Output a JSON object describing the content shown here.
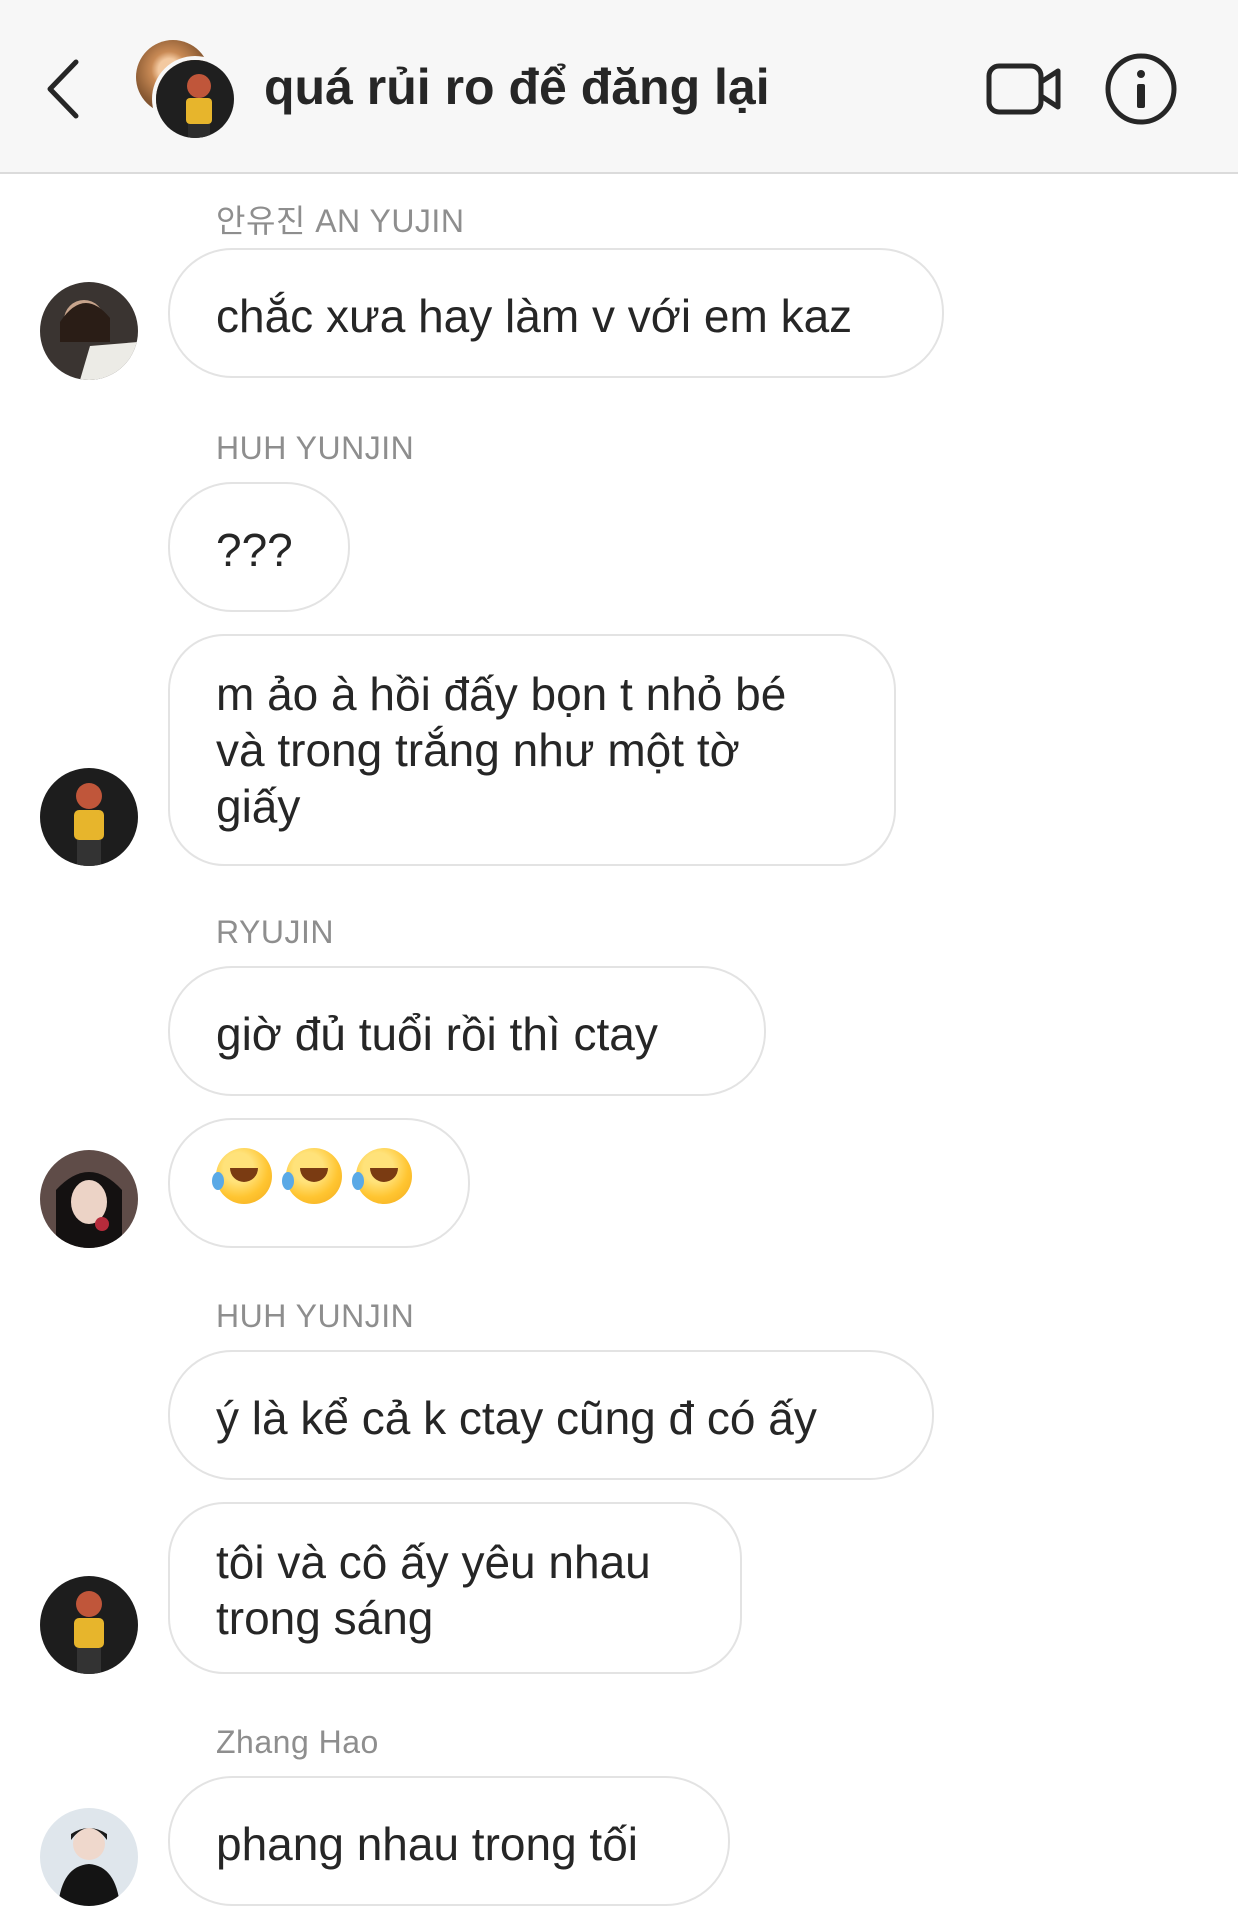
{
  "header": {
    "title": "quá rủi ro để đăng lại",
    "back_icon": "chevron-left-icon",
    "video_icon": "video-camera-icon",
    "info_icon": "info-icon"
  },
  "messages": [
    {
      "sender": "안유진 AN YUJIN",
      "text": "chắc xưa hay làm v với em kaz"
    },
    {
      "sender": "HUH YUNJIN",
      "text": "???"
    },
    {
      "text_lines": [
        "m ảo à hồi đấy bọn t nhỏ bé",
        "và trong trắng như một tờ",
        "giấy"
      ]
    },
    {
      "sender": "RYUJIN",
      "text": "giờ đủ tuổi rồi thì ctay"
    },
    {
      "emoji": "rolling-on-floor-laughing",
      "count": 3
    },
    {
      "sender": "HUH YUNJIN",
      "text": "ý là kể cả k ctay cũng đ có ấy"
    },
    {
      "text_lines": [
        "tôi và cô ấy yêu nhau",
        "trong sáng"
      ]
    },
    {
      "sender": "Zhang Hao",
      "text": "phang nhau trong tối"
    }
  ],
  "colors": {
    "header_bg": "#f7f7f7",
    "bubble_border": "#e3e3e3",
    "text": "#262626",
    "sender_text": "#8e8e8e"
  }
}
